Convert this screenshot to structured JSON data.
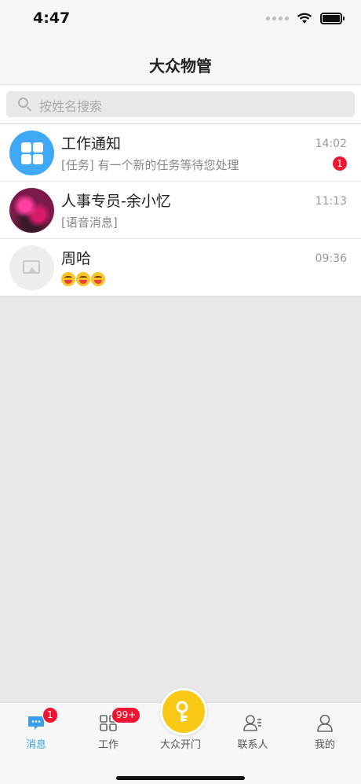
{
  "status_bar": {
    "time": "4:47"
  },
  "nav": {
    "title": "大众物管"
  },
  "search": {
    "placeholder": "按姓名搜索"
  },
  "conversations": [
    {
      "name": "工作通知",
      "preview": "[任务] 有一个新的任务等待您处理",
      "time": "14:02",
      "unread": "1",
      "avatar": "grid-app-icon"
    },
    {
      "name": "人事专员-余小忆",
      "preview": "[语音消息]",
      "time": "11:13",
      "avatar": "flower-photo"
    },
    {
      "name": "周哈",
      "preview_emojis": 3,
      "time": "09:36",
      "avatar": "image-placeholder-icon"
    }
  ],
  "tab_bar": {
    "items": [
      {
        "label": "消息",
        "badge": "1",
        "active": true
      },
      {
        "label": "工作",
        "badge": "99+"
      },
      {
        "label": "大众开门"
      },
      {
        "label": "联系人"
      },
      {
        "label": "我的"
      }
    ]
  },
  "colors": {
    "accent": "#3a9fe8",
    "badge": "#f01432",
    "center_button": "#f7c814",
    "app_icon": "#3fa9f5"
  }
}
